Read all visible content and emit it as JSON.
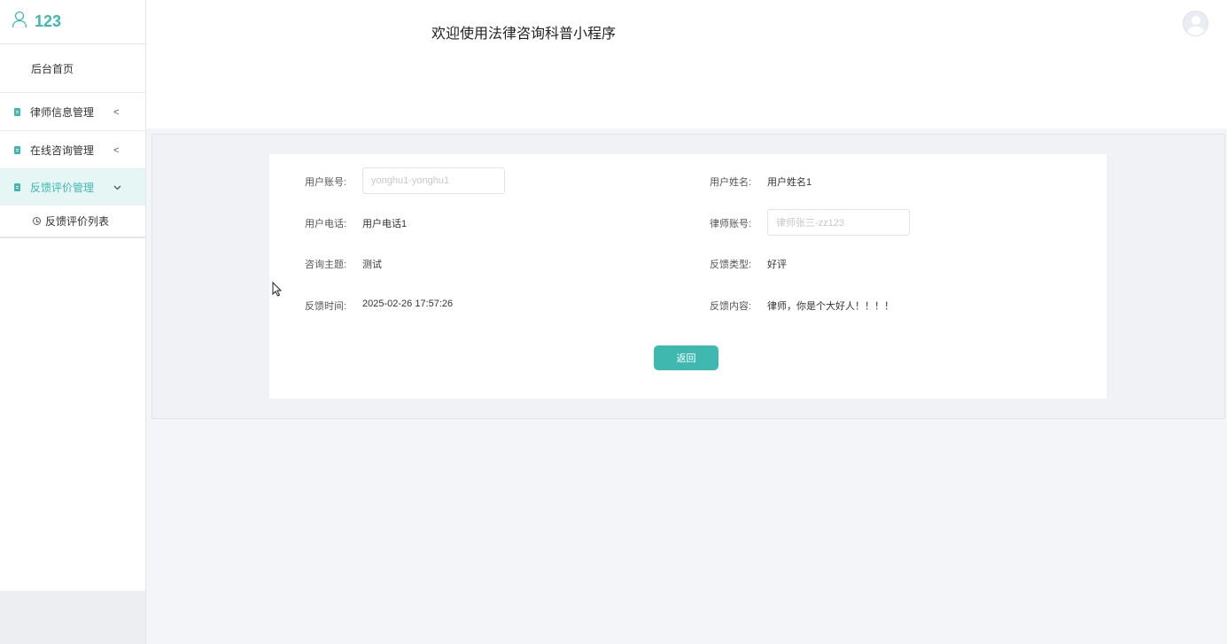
{
  "app": {
    "username": "123",
    "title": "欢迎使用法律咨询科普小程序"
  },
  "sidebar": {
    "home": "后台首页",
    "items": [
      {
        "label": "律师信息管理",
        "chevron": "<"
      },
      {
        "label": "在线咨询管理",
        "chevron": "<"
      },
      {
        "label": "反馈评价管理",
        "chevron": "v"
      }
    ],
    "sub_items": [
      {
        "label": "反馈评价列表"
      }
    ]
  },
  "form": {
    "user_account": {
      "label": "用户账号:",
      "placeholder": "yonghu1-yonghu1"
    },
    "user_name": {
      "label": "用户姓名:",
      "value": "用户姓名1"
    },
    "user_phone": {
      "label": "用户电话:",
      "value": "用户电话1"
    },
    "lawyer_account": {
      "label": "律师账号:",
      "placeholder": "律师张三-zz123"
    },
    "consult_topic": {
      "label": "咨询主题:",
      "value": "测试"
    },
    "feedback_type": {
      "label": "反馈类型:",
      "value": "好评"
    },
    "feedback_time": {
      "label": "反馈时间:",
      "value": "2025-02-26 17:57:26"
    },
    "feedback_content": {
      "label": "反馈内容:",
      "value": "律师，你是个大好人！！！！"
    }
  },
  "buttons": {
    "back": "返回"
  },
  "colors": {
    "accent": "#3fb8af"
  }
}
